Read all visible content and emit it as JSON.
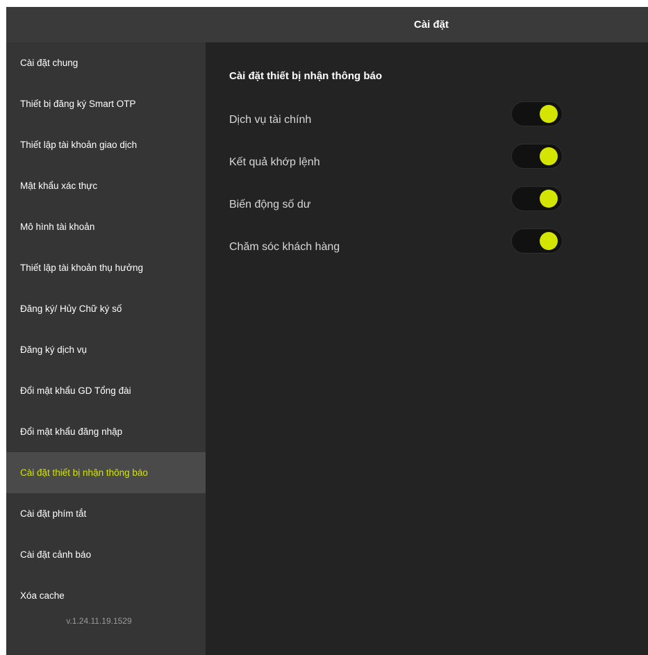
{
  "window": {
    "title": "Cài đặt"
  },
  "sidebar": {
    "items": [
      {
        "label": "Cài đặt chung",
        "active": false
      },
      {
        "label": "Thiết bị đăng ký Smart OTP",
        "active": false
      },
      {
        "label": "Thiết lập tài khoản giao dịch",
        "active": false
      },
      {
        "label": "Mật khẩu xác thực",
        "active": false
      },
      {
        "label": "Mô hình tài khoản",
        "active": false
      },
      {
        "label": "Thiết lập tài khoản thụ hưởng",
        "active": false
      },
      {
        "label": "Đăng ký/ Hủy Chữ ký số",
        "active": false
      },
      {
        "label": "Đăng ký dịch vụ",
        "active": false
      },
      {
        "label": "Đổi mật khẩu GD Tổng đài",
        "active": false
      },
      {
        "label": "Đổi mật khẩu đăng nhập",
        "active": false
      },
      {
        "label": "Cài đặt thiết bị nhận thông báo",
        "active": true
      },
      {
        "label": "Cài đặt phím tắt",
        "active": false
      },
      {
        "label": "Cài đặt cảnh báo",
        "active": false
      },
      {
        "label": "Xóa cache",
        "active": false
      }
    ],
    "version": "v.1.24.11.19.1529"
  },
  "main": {
    "section_title": "Cài đặt thiết bị nhận thông báo",
    "toggles": [
      {
        "label": "Dịch vụ tài chính",
        "on": true
      },
      {
        "label": "Kết quả khớp lệnh",
        "on": true
      },
      {
        "label": "Biến động số dư",
        "on": true
      },
      {
        "label": "Chăm sóc khách hàng",
        "on": true
      }
    ]
  },
  "colors": {
    "accent": "#d4e600",
    "sidebar_bg": "#353535",
    "main_bg": "#232323",
    "titlebar_bg": "#3a3a3a",
    "active_item_bg": "#4a4a4a"
  }
}
